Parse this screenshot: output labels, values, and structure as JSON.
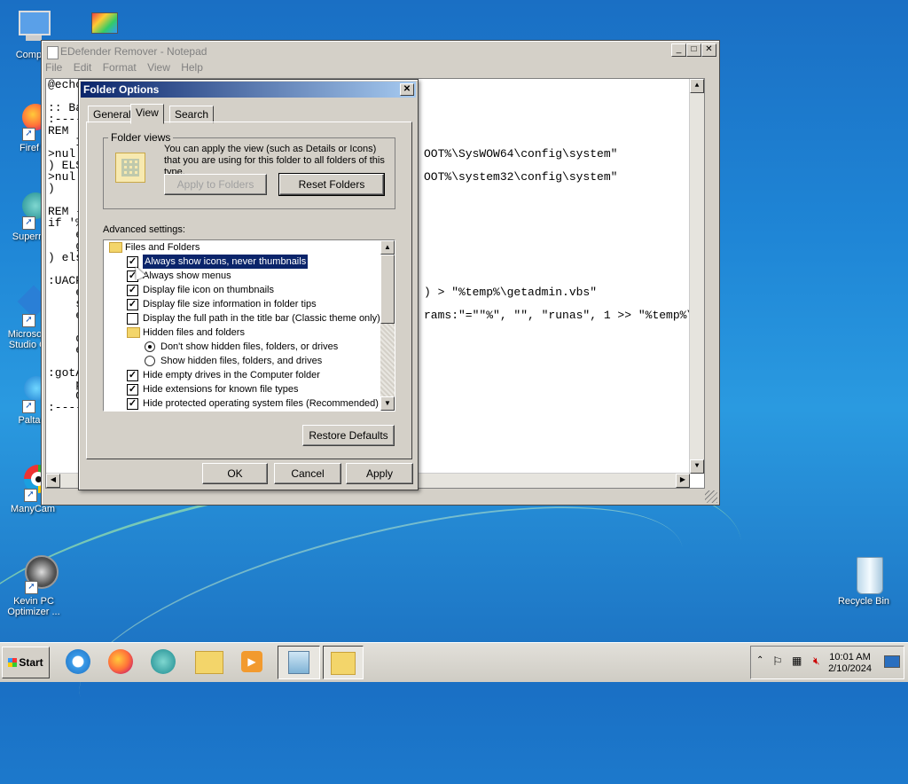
{
  "desktop": {
    "icons": [
      {
        "label": "Computer",
        "display": "Comput"
      },
      {
        "label": "",
        "display": ""
      },
      {
        "label": "Firefox",
        "display": "Firef"
      },
      {
        "label": "Supermium",
        "display": "Superm"
      },
      {
        "label": "Microsoft Visual Studio Code",
        "display": "Microsoft Studio C"
      },
      {
        "label": "Palta",
        "display": "Palta"
      },
      {
        "label": "ManyCam",
        "display": "ManyCam"
      },
      {
        "label": "Kevin PC Optimizer",
        "display": "Kevin PC Optimizer ..."
      },
      {
        "label": "Recycle Bin",
        "display": "Recycle Bin"
      }
    ]
  },
  "notepad": {
    "title": "EDefender Remover - Notepad",
    "menu": [
      "File",
      "Edit",
      "Format",
      "View",
      "Help"
    ],
    "visible_lines_left": [
      "@echo",
      "",
      ":: Ba",
      ":----",
      "REM",
      "    I",
      ">nul",
      ") ELS",
      ">nul",
      ")",
      "",
      "REM -",
      "if '%",
      "    e",
      "    g",
      ") els",
      "",
      ":UACP",
      "    e",
      "    s",
      "    e",
      "     .",
      "    d",
      "    e",
      "",
      ":gotA",
      "    p",
      "    C",
      ":----"
    ],
    "visible_lines_right": [
      {
        "line": 6,
        "text": "OOT%\\SysWOW64\\config\\system\""
      },
      {
        "line": 8,
        "text": "OOT%\\system32\\config\\system\""
      },
      {
        "line": 18,
        "text": ") > \"%temp%\\getadmin.vbs\""
      },
      {
        "line": 20,
        "text": "rams:\"=\"\"%\", \"\", \"runas\", 1 >> \"%temp%\\"
      }
    ]
  },
  "folder_options": {
    "title": "Folder Options",
    "tabs": [
      "General",
      "View",
      "Search"
    ],
    "active_tab": "View",
    "folder_views": {
      "legend": "Folder views",
      "description": "You can apply the view (such as Details or Icons) that you are using for this folder to all folders of this type.",
      "apply_button": "Apply to Folders",
      "reset_button": "Reset Folders"
    },
    "advanced_label": "Advanced settings:",
    "settings": [
      {
        "type": "folder",
        "label": "Files and Folders",
        "indent": 0
      },
      {
        "type": "checkbox",
        "label": "Always show icons, never thumbnails",
        "checked": true,
        "selected": true,
        "indent": 1
      },
      {
        "type": "checkbox",
        "label": "Always show menus",
        "checked": true,
        "indent": 1
      },
      {
        "type": "checkbox",
        "label": "Display file icon on thumbnails",
        "checked": true,
        "indent": 1
      },
      {
        "type": "checkbox",
        "label": "Display file size information in folder tips",
        "checked": true,
        "indent": 1
      },
      {
        "type": "checkbox",
        "label": "Display the full path in the title bar (Classic theme only)",
        "checked": false,
        "indent": 1
      },
      {
        "type": "folder",
        "label": "Hidden files and folders",
        "indent": 1
      },
      {
        "type": "radio",
        "label": "Don't show hidden files, folders, or drives",
        "checked": true,
        "indent": 2
      },
      {
        "type": "radio",
        "label": "Show hidden files, folders, and drives",
        "checked": false,
        "indent": 2
      },
      {
        "type": "checkbox",
        "label": "Hide empty drives in the Computer folder",
        "checked": true,
        "indent": 1
      },
      {
        "type": "checkbox",
        "label": "Hide extensions for known file types",
        "checked": true,
        "indent": 1
      },
      {
        "type": "checkbox",
        "label": "Hide protected operating system files (Recommended)",
        "checked": true,
        "indent": 1
      }
    ],
    "restore_button": "Restore Defaults",
    "ok_button": "OK",
    "cancel_button": "Cancel",
    "apply_button": "Apply"
  },
  "taskbar": {
    "start_label": "Start",
    "time": "10:01 AM",
    "date": "2/10/2024"
  }
}
